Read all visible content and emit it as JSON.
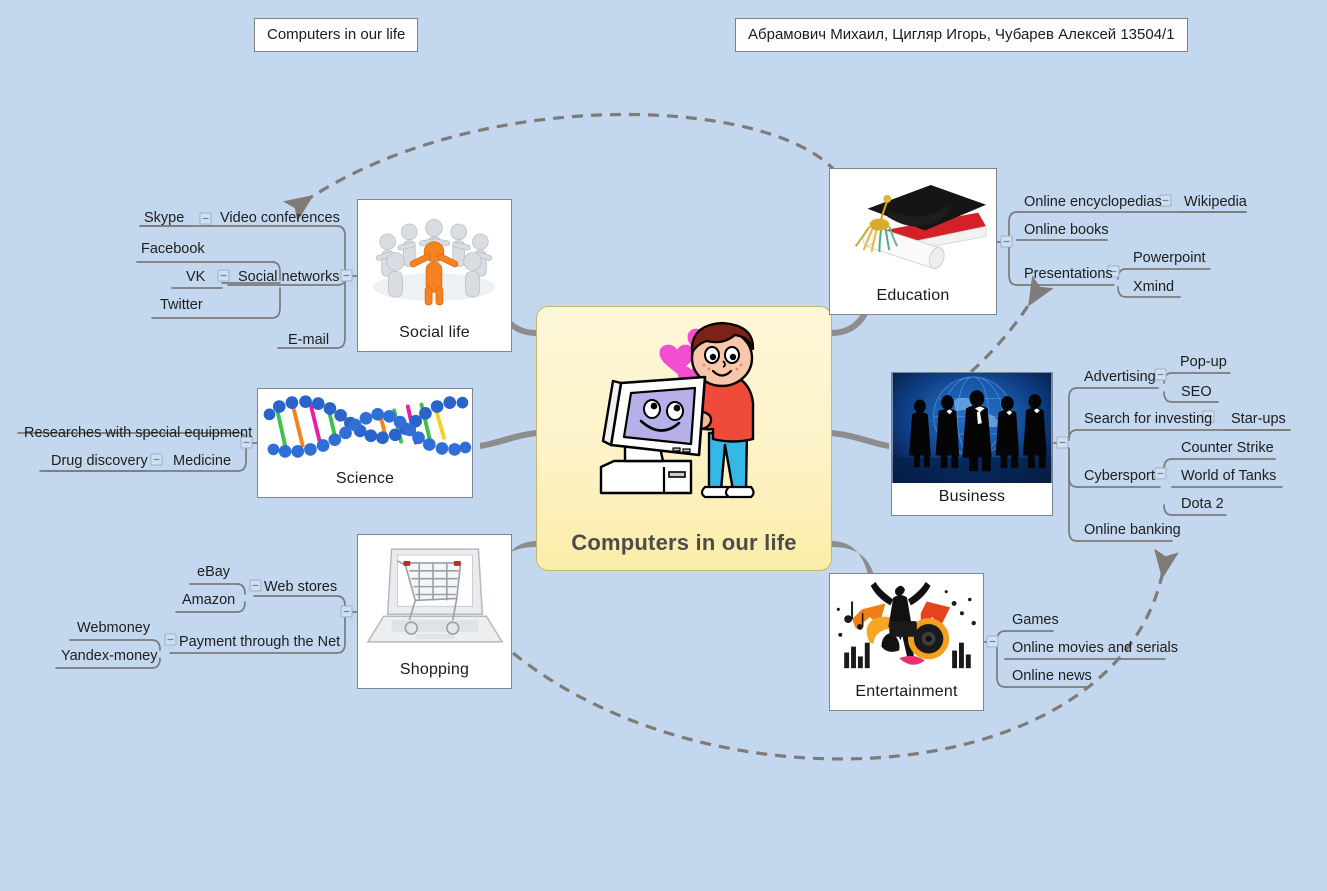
{
  "meta": {
    "app": "xmind-mind-map",
    "background_color": "#c3d7ee",
    "connector_color": "#8d8d8d",
    "relationship_color": "#7f7b78",
    "central_fill": "#fdf3c8",
    "central_border": "#c9b56b",
    "node_border": "#7a8694",
    "node_fill": "#ffffff"
  },
  "header": {
    "left_title": "Computers in our life",
    "right_title": "Абрамович Михаил, Цигляр Игорь, Чубарев Алексей 13504/1"
  },
  "central": {
    "label": "Computers in our life",
    "image_name": "boy-hugging-computer-illustration"
  },
  "branches": [
    {
      "id": "social-life",
      "label": "Social life",
      "image_name": "people-circle-3d-figures-image",
      "side": "left",
      "children": [
        {
          "label": "Video conferences",
          "children": [
            {
              "label": "Skype"
            }
          ]
        },
        {
          "label": "Social networks",
          "children": [
            {
              "label": "Facebook"
            },
            {
              "label": "VK"
            },
            {
              "label": "Twitter"
            }
          ]
        },
        {
          "label": "E-mail",
          "children": []
        }
      ]
    },
    {
      "id": "science",
      "label": "Science",
      "image_name": "dna-double-helix-image",
      "side": "left",
      "children": [
        {
          "label": "Researches with special equipment",
          "children": []
        },
        {
          "label": "Medicine",
          "children": [
            {
              "label": "Drug discovery"
            }
          ]
        }
      ]
    },
    {
      "id": "shopping",
      "label": "Shopping",
      "image_name": "laptop-shopping-cart-image",
      "side": "left",
      "children": [
        {
          "label": "Web stores",
          "children": [
            {
              "label": "eBay"
            },
            {
              "label": "Amazon"
            }
          ]
        },
        {
          "label": "Payment through the Net",
          "children": [
            {
              "label": "Webmoney"
            },
            {
              "label": "Yandex-money"
            }
          ]
        }
      ]
    },
    {
      "id": "education",
      "label": "Education",
      "image_name": "graduation-cap-diploma-image",
      "side": "right",
      "children": [
        {
          "label": "Online encyclopedias",
          "children": [
            {
              "label": "Wikipedia"
            }
          ]
        },
        {
          "label": "Online books",
          "children": []
        },
        {
          "label": "Presentations",
          "children": [
            {
              "label": "Powerpoint"
            },
            {
              "label": "Xmind"
            }
          ]
        }
      ]
    },
    {
      "id": "business",
      "label": "Business",
      "image_name": "business-people-globe-image",
      "side": "right",
      "children": [
        {
          "label": "Advertising",
          "children": [
            {
              "label": "Pop-up"
            },
            {
              "label": "SEO"
            }
          ]
        },
        {
          "label": "Search for investing",
          "children": [
            {
              "label": "Star-ups"
            }
          ]
        },
        {
          "label": "Cybersport",
          "children": [
            {
              "label": "Counter Strike"
            },
            {
              "label": "World of Tanks"
            },
            {
              "label": "Dota 2"
            }
          ]
        },
        {
          "label": "Online banking",
          "children": []
        }
      ]
    },
    {
      "id": "entertainment",
      "label": "Entertainment",
      "image_name": "music-dancer-speakers-image",
      "side": "right",
      "children": [
        {
          "label": "Games",
          "children": []
        },
        {
          "label": "Online movies and serials",
          "children": []
        },
        {
          "label": "Online news",
          "children": []
        }
      ]
    }
  ],
  "relationships": [
    {
      "id": "rel-education-to-video-conferences",
      "from": "Education",
      "to": "Video conferences"
    },
    {
      "id": "rel-business-to-presentations",
      "from": "Business",
      "to": "Presentations"
    },
    {
      "id": "rel-shopping-to-online-banking",
      "from": "Shopping",
      "to": "Online banking"
    }
  ],
  "labels": {
    "social": {
      "skype": "Skype",
      "video_conferences": "Video conferences",
      "facebook": "Facebook",
      "vk": "VK",
      "social_networks": "Social networks",
      "twitter": "Twitter",
      "email": "E-mail",
      "caption": "Social life"
    },
    "science": {
      "researches": "Researches with special equipment",
      "drug_discovery": "Drug discovery",
      "medicine": "Medicine",
      "caption": "Science"
    },
    "shopping": {
      "ebay": "eBay",
      "web_stores": "Web stores",
      "amazon": "Amazon",
      "webmoney": "Webmoney",
      "payment": "Payment through the Net",
      "yandex": "Yandex-money",
      "caption": "Shopping"
    },
    "education": {
      "online_encyclopedias": "Online encyclopedias",
      "wikipedia": "Wikipedia",
      "online_books": "Online books",
      "powerpoint": "Powerpoint",
      "presentations": "Presentations",
      "xmind": "Xmind",
      "caption": "Education"
    },
    "business": {
      "popup": "Pop-up",
      "advertising": "Advertising",
      "seo": "SEO",
      "search_investing": "Search for investing",
      "starups": "Star-ups",
      "counter_strike": "Counter Strike",
      "cybersport": "Cybersport",
      "wot": "World of Tanks",
      "dota": "Dota 2",
      "online_banking": "Online banking",
      "caption": "Business"
    },
    "entertainment": {
      "games": "Games",
      "movies": "Online movies and serials",
      "news": "Online news",
      "caption": "Entertainment"
    }
  }
}
